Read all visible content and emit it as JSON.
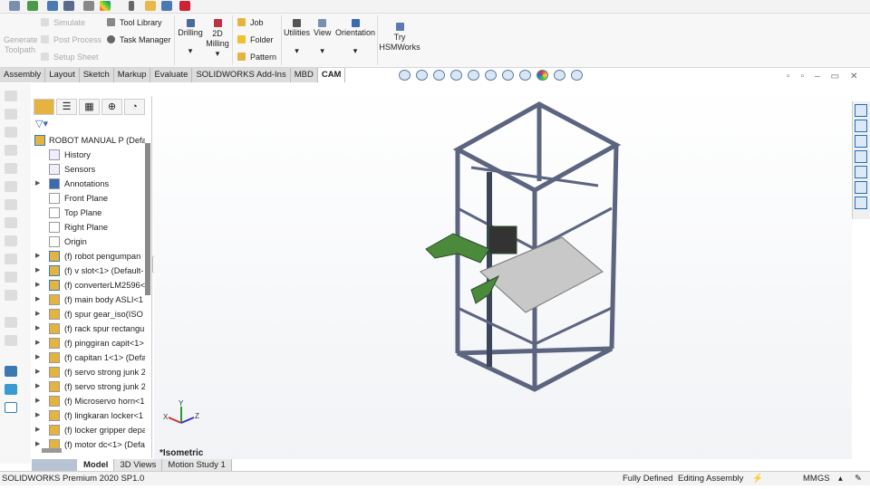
{
  "ribbon": {
    "generate_toolpath": "Generate Toolpath",
    "simulate": "Simulate",
    "post_process": "Post Process",
    "setup_sheet": "Setup Sheet",
    "tool_library": "Tool Library",
    "task_manager": "Task Manager",
    "drilling": "Drilling",
    "milling_2d": "2D Milling",
    "job": "Job",
    "folder": "Folder",
    "pattern": "Pattern",
    "utilities": "Utilities",
    "view": "View",
    "orientation": "Orientation",
    "try_hsm": "Try HSMWorks"
  },
  "tabs": [
    "Assembly",
    "Layout",
    "Sketch",
    "Markup",
    "Evaluate",
    "SOLIDWORKS Add-Ins",
    "MBD",
    "CAM"
  ],
  "active_tab": "CAM",
  "tree": {
    "root": "ROBOT MANUAL P  (Defa",
    "items": [
      {
        "label": "History",
        "expand": false,
        "icon": "history-icon"
      },
      {
        "label": "Sensors",
        "expand": false,
        "icon": "sensors-icon"
      },
      {
        "label": "Annotations",
        "expand": true,
        "icon": "annotations-icon"
      },
      {
        "label": "Front Plane",
        "expand": false,
        "icon": "plane-icon"
      },
      {
        "label": "Top Plane",
        "expand": false,
        "icon": "plane-icon"
      },
      {
        "label": "Right Plane",
        "expand": false,
        "icon": "plane-icon"
      },
      {
        "label": "Origin",
        "expand": false,
        "icon": "origin-icon"
      },
      {
        "label": "(f) robot pengumpan",
        "expand": true,
        "icon": "subassembly-icon"
      },
      {
        "label": "(f) v slot<1> (Default-",
        "expand": true,
        "icon": "subassembly-icon"
      },
      {
        "label": "(f) converterLM2596<",
        "expand": true,
        "icon": "subassembly-icon"
      },
      {
        "label": "(f) main body ASLI<1",
        "expand": true,
        "icon": "part-icon"
      },
      {
        "label": "(f) spur gear_iso(ISO -",
        "expand": true,
        "icon": "part-icon"
      },
      {
        "label": "(f) rack spur rectangul",
        "expand": true,
        "icon": "part-icon"
      },
      {
        "label": "(f) pinggiran capit<1>",
        "expand": true,
        "icon": "part-icon"
      },
      {
        "label": "(f) capitan 1<1> (Defa",
        "expand": true,
        "icon": "part-icon"
      },
      {
        "label": "(f) servo strong junk 2",
        "expand": true,
        "icon": "part-icon"
      },
      {
        "label": "(f) servo strong junk 2",
        "expand": true,
        "icon": "part-icon"
      },
      {
        "label": "(f) Microservo horn<1",
        "expand": true,
        "icon": "part-icon"
      },
      {
        "label": "(f) lingkaran locker<1",
        "expand": true,
        "icon": "part-icon"
      },
      {
        "label": "(f) locker gripper depa",
        "expand": true,
        "icon": "part-icon"
      },
      {
        "label": "(f) motor dc<1> (Defa",
        "expand": true,
        "icon": "part-icon"
      }
    ]
  },
  "viewport": {
    "view_label": "*Isometric",
    "triad": {
      "x": "X",
      "y": "Y",
      "z": "Z"
    }
  },
  "bottom_tabs": [
    "Model",
    "3D Views",
    "Motion Study 1"
  ],
  "status": {
    "product": "SOLIDWORKS Premium 2020 SP1.0",
    "state": "Fully Defined",
    "mode": "Editing Assembly",
    "units": "MMGS"
  },
  "colors": {
    "frame": "#6e7690",
    "bracket": "#4a8a3a",
    "plate": "#c8c8c8"
  }
}
